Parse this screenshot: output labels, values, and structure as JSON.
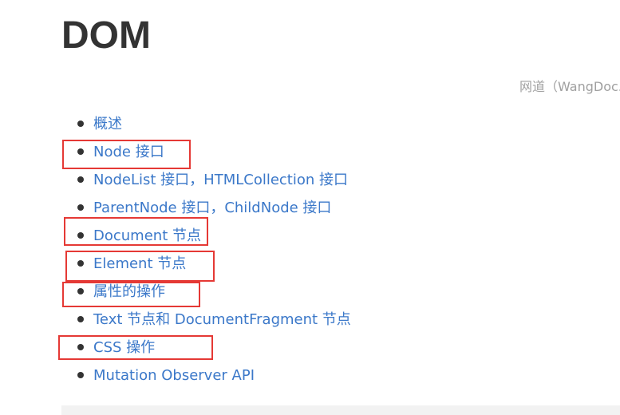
{
  "page": {
    "title": "DOM",
    "source": "网道（WangDoc."
  },
  "toc": {
    "items": [
      {
        "label": "概述"
      },
      {
        "label": "Node 接口"
      },
      {
        "label": "NodeList 接口，HTMLCollection 接口"
      },
      {
        "label": "ParentNode 接口，ChildNode 接口"
      },
      {
        "label": "Document 节点"
      },
      {
        "label": "Element 节点"
      },
      {
        "label": "属性的操作"
      },
      {
        "label": "Text 节点和 DocumentFragment 节点"
      },
      {
        "label": "CSS 操作"
      },
      {
        "label": "Mutation Observer API"
      }
    ]
  },
  "colors": {
    "link": "#3b78c9",
    "title": "#333333",
    "source": "#a0a0a0",
    "highlight": "#e53935"
  }
}
